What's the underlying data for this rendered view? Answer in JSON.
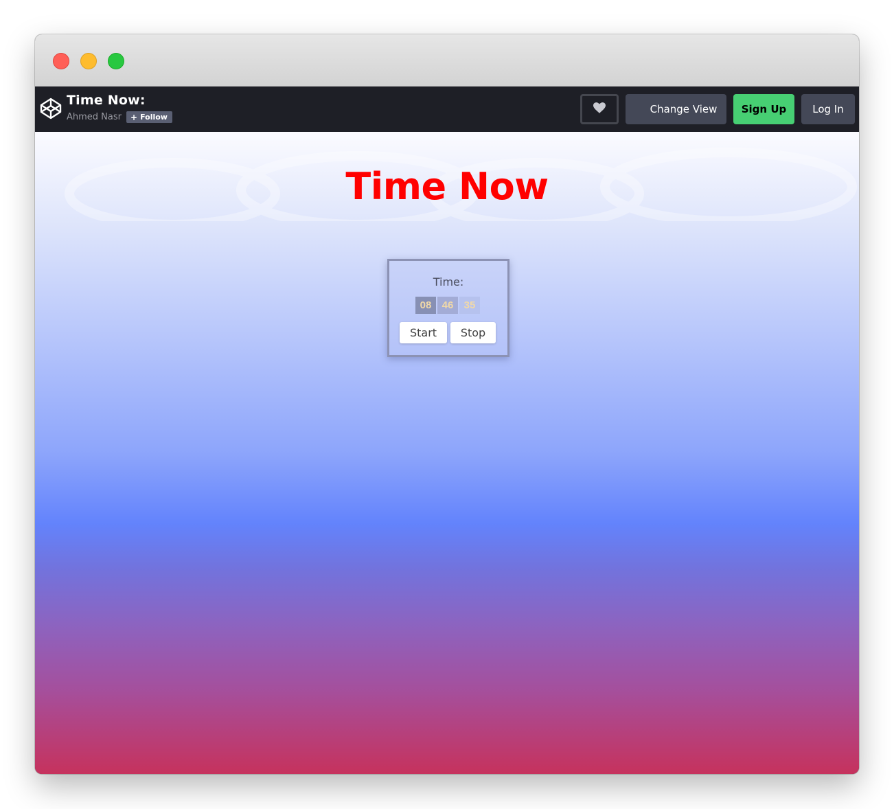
{
  "window": {
    "controls": [
      "close",
      "minimize",
      "maximize"
    ]
  },
  "navbar": {
    "logo_icon": "codepen-logo-icon",
    "pen_title": "Time Now:",
    "author": "Ahmed Nasr",
    "follow_label": "Follow",
    "heart_icon": "heart-icon",
    "change_view_label": "Change View",
    "sign_up_label": "Sign Up",
    "log_in_label": "Log In",
    "colors": {
      "background": "#1e1f26",
      "sign_up": "#47cf73",
      "button": "#444857"
    }
  },
  "page": {
    "heading": "Time Now",
    "heading_color": "#ff0000"
  },
  "clock": {
    "label": "Time:",
    "hours": "08",
    "minutes": "46",
    "seconds": "35",
    "start_label": "Start",
    "stop_label": "Stop"
  }
}
